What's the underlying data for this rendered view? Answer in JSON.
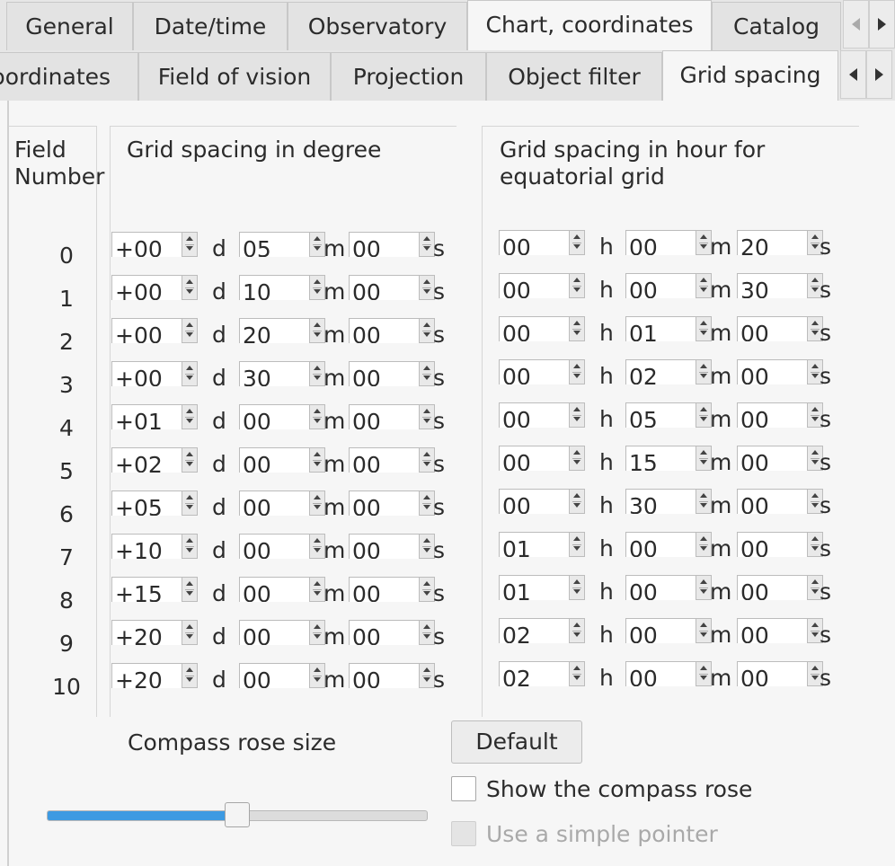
{
  "top_tabs": [
    {
      "label": "General",
      "active": false
    },
    {
      "label": "Date/time",
      "active": false
    },
    {
      "label": "Observatory",
      "active": false
    },
    {
      "label": "Chart, coordinates",
      "active": true
    },
    {
      "label": "Catalog",
      "active": false
    }
  ],
  "sub_tabs": [
    {
      "label": "Coordinates",
      "active": false
    },
    {
      "label": "Field of vision",
      "active": false
    },
    {
      "label": "Projection",
      "active": false
    },
    {
      "label": "Object filter",
      "active": false
    },
    {
      "label": "Grid spacing",
      "active": true
    }
  ],
  "headers": {
    "field_number": "Field\nNumber",
    "degree": "Grid spacing in degree",
    "hour": "Grid spacing in hour for\nequatorial grid"
  },
  "units": {
    "d": "d",
    "m": "m",
    "s": "s",
    "h": "h"
  },
  "rows": [
    {
      "field": "0",
      "deg": "+00",
      "dmin": "05",
      "dsec": "00",
      "hour": "00",
      "hmin": "00",
      "hsec": "20"
    },
    {
      "field": "1",
      "deg": "+00",
      "dmin": "10",
      "dsec": "00",
      "hour": "00",
      "hmin": "00",
      "hsec": "30"
    },
    {
      "field": "2",
      "deg": "+00",
      "dmin": "20",
      "dsec": "00",
      "hour": "00",
      "hmin": "01",
      "hsec": "00"
    },
    {
      "field": "3",
      "deg": "+00",
      "dmin": "30",
      "dsec": "00",
      "hour": "00",
      "hmin": "02",
      "hsec": "00"
    },
    {
      "field": "4",
      "deg": "+01",
      "dmin": "00",
      "dsec": "00",
      "hour": "00",
      "hmin": "05",
      "hsec": "00"
    },
    {
      "field": "5",
      "deg": "+02",
      "dmin": "00",
      "dsec": "00",
      "hour": "00",
      "hmin": "15",
      "hsec": "00"
    },
    {
      "field": "6",
      "deg": "+05",
      "dmin": "00",
      "dsec": "00",
      "hour": "00",
      "hmin": "30",
      "hsec": "00"
    },
    {
      "field": "7",
      "deg": "+10",
      "dmin": "00",
      "dsec": "00",
      "hour": "01",
      "hmin": "00",
      "hsec": "00"
    },
    {
      "field": "8",
      "deg": "+15",
      "dmin": "00",
      "dsec": "00",
      "hour": "01",
      "hmin": "00",
      "hsec": "00"
    },
    {
      "field": "9",
      "deg": "+20",
      "dmin": "00",
      "dsec": "00",
      "hour": "02",
      "hmin": "00",
      "hsec": "00"
    },
    {
      "field": "10",
      "deg": "+20",
      "dmin": "00",
      "dsec": "00",
      "hour": "02",
      "hmin": "00",
      "hsec": "00"
    }
  ],
  "compass": {
    "label": "Compass rose size",
    "slider_level": 0.5,
    "default_button": "Default",
    "show_compass": {
      "label": "Show the compass rose",
      "checked": false
    },
    "simple_pointer": {
      "label": "Use a simple pointer",
      "checked": false,
      "disabled": true
    }
  },
  "colors": {
    "slider_fill": "#3d9ae2"
  }
}
